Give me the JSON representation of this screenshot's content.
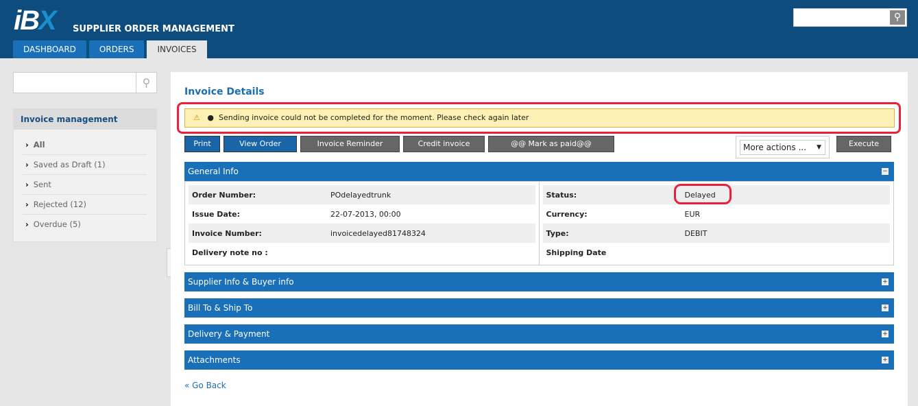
{
  "header": {
    "logo_text": "iBX",
    "title": "SUPPLIER ORDER MANAGEMENT",
    "tabs": [
      {
        "label": "DASHBOARD"
      },
      {
        "label": "ORDERS"
      },
      {
        "label": "INVOICES",
        "active": true
      }
    ],
    "search_icon": "search-icon"
  },
  "sidebar": {
    "title": "Invoice management",
    "items": [
      {
        "label": "All",
        "active": true
      },
      {
        "label": "Saved as Draft (1)"
      },
      {
        "label": "Sent"
      },
      {
        "label": "Rejected (12)"
      },
      {
        "label": "Overdue (5)"
      }
    ]
  },
  "main": {
    "title": "Invoice Details",
    "alert": {
      "icon": "warning-icon",
      "message": "Sending invoice could not be completed for the moment. Please check again later"
    },
    "buttons": {
      "print": "Print",
      "view_order": "View Order",
      "reminder": "Invoice Reminder",
      "credit": "Credit invoice",
      "mark_paid": "@@ Mark as paid@@",
      "more_actions": "More actions ...",
      "execute": "Execute"
    },
    "general_info": {
      "title": "General Info",
      "left": [
        {
          "label": "Order Number:",
          "value": "POdelayedtrunk"
        },
        {
          "label": "Issue Date:",
          "value": "22-07-2013, 00:00"
        },
        {
          "label": "Invoice Number:",
          "value": "invoicedelayed81748324"
        },
        {
          "label": "Delivery note no :",
          "value": ""
        }
      ],
      "right": [
        {
          "label": "Status:",
          "value": "Delayed"
        },
        {
          "label": "Currency:",
          "value": "EUR"
        },
        {
          "label": "Type:",
          "value": "DEBIT"
        },
        {
          "label": "Shipping Date",
          "value": ""
        }
      ]
    },
    "sections": [
      "Supplier Info & Buyer info",
      "Bill To & Ship To",
      "Delivery & Payment",
      "Attachments"
    ],
    "go_back": "« Go Back"
  },
  "colors": {
    "header": "#0e4c7e",
    "accent": "#1a70b8",
    "alert_bg": "#fdf0b4",
    "highlight": "#e8203c"
  }
}
